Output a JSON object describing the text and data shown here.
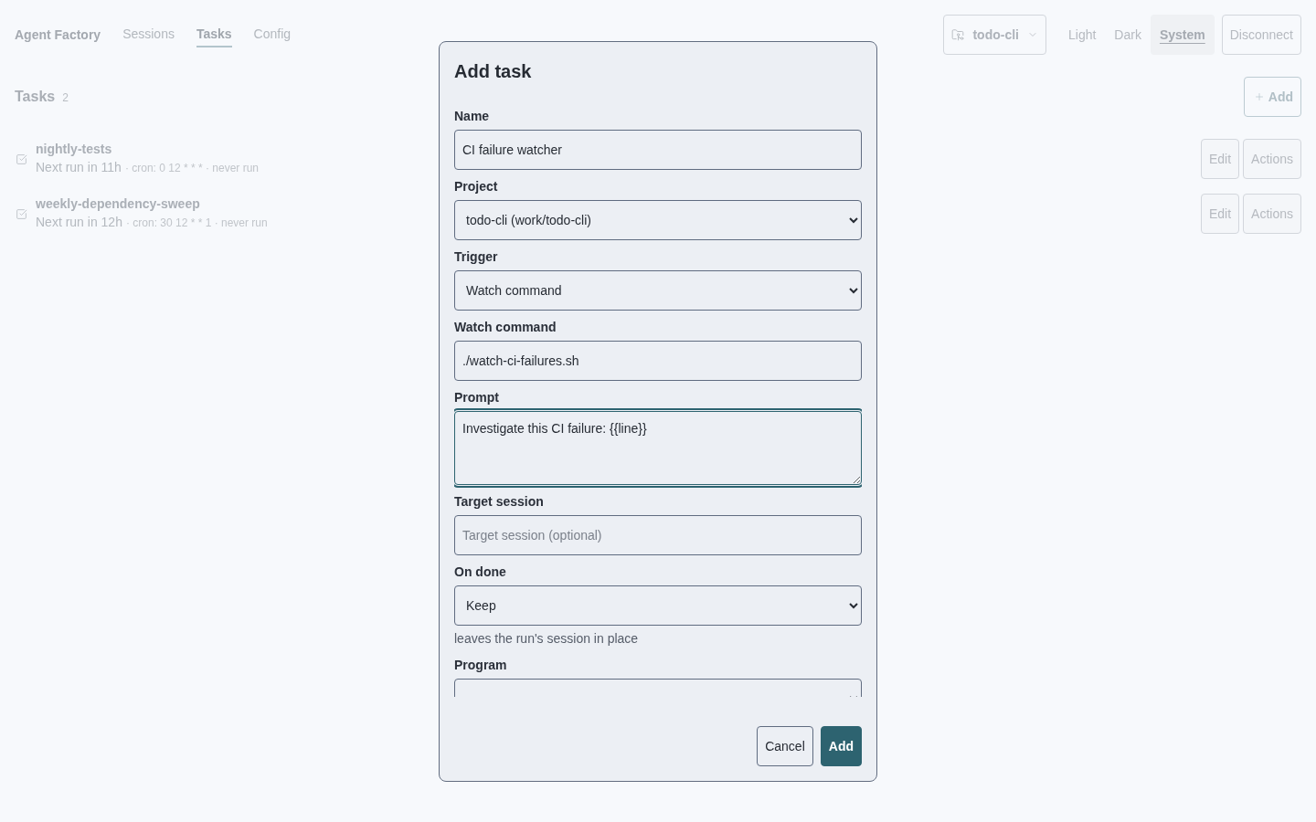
{
  "nav": {
    "brand": "Agent Factory",
    "tabs": [
      {
        "label": "Sessions",
        "selected": false
      },
      {
        "label": "Tasks",
        "selected": true
      },
      {
        "label": "Config",
        "selected": false
      }
    ]
  },
  "project_switcher": {
    "label": "todo-cli"
  },
  "theme_options": [
    {
      "label": "Light",
      "selected": false
    },
    {
      "label": "Dark",
      "selected": false
    },
    {
      "label": "System",
      "selected": true
    }
  ],
  "disconnect_button": "Disconnect",
  "tasks_header": {
    "title": "Tasks",
    "count": "2",
    "add_button": "Add"
  },
  "tasks": [
    {
      "name": "nightly-tests",
      "next_run": "Next run in 11h",
      "schedule": "· cron: 0 12 * * * · never run",
      "actions": [
        "Edit",
        "Actions"
      ]
    },
    {
      "name": "weekly-dependency-sweep",
      "next_run": "Next run in 12h",
      "schedule": "· cron: 30 12 * * 1 · never run",
      "actions": [
        "Edit",
        "Actions"
      ]
    }
  ],
  "dialog": {
    "title": "Add task",
    "fields": [
      {
        "kind": "input",
        "label": "Name",
        "value": "CI failure watcher",
        "focused": false
      },
      {
        "kind": "select",
        "label": "Project",
        "value": "todo-cli (work/todo-cli)",
        "focused": false
      },
      {
        "kind": "select",
        "label": "Trigger",
        "value": "Watch command",
        "focused": false
      },
      {
        "kind": "input",
        "label": "Watch command",
        "value": "./watch-ci-failures.sh",
        "focused": false
      },
      {
        "kind": "textarea",
        "label": "Prompt",
        "value": "Investigate this CI failure: {{line}}",
        "focused": true
      },
      {
        "kind": "input",
        "label": "Target session",
        "placeholder": "Target session (optional)",
        "focused": false
      },
      {
        "kind": "select",
        "label": "On done",
        "value": "Keep",
        "hint": "leaves the run's session in place",
        "focused": false
      },
      {
        "kind": "select",
        "label": "Program",
        "focused": false
      }
    ],
    "buttons": [
      {
        "label": "Cancel",
        "kind": "secondary"
      },
      {
        "label": "Add",
        "kind": "primary"
      }
    ]
  }
}
